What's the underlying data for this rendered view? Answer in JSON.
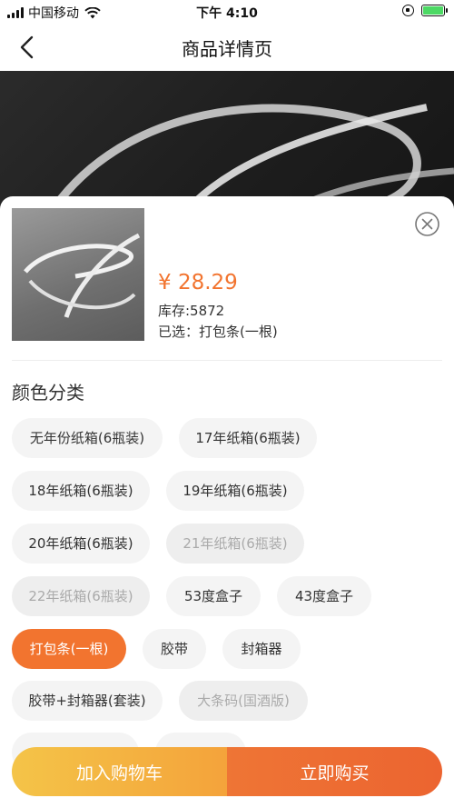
{
  "status_bar": {
    "carrier": "中国移动",
    "time": "下午 4:10"
  },
  "nav": {
    "title": "商品详情页"
  },
  "product": {
    "price": "¥ 28.29",
    "stock": "库存:5872",
    "selected": "已选：打包条(一根)"
  },
  "section": {
    "title": "颜色分类"
  },
  "options": [
    {
      "label": "无年份纸箱(6瓶装)",
      "state": "normal"
    },
    {
      "label": "17年纸箱(6瓶装)",
      "state": "normal"
    },
    {
      "label": "18年纸箱(6瓶装)",
      "state": "normal"
    },
    {
      "label": "19年纸箱(6瓶装)",
      "state": "normal"
    },
    {
      "label": "20年纸箱(6瓶装)",
      "state": "normal"
    },
    {
      "label": "21年纸箱(6瓶装)",
      "state": "disabled"
    },
    {
      "label": "22年纸箱(6瓶装)",
      "state": "disabled"
    },
    {
      "label": "53度盒子",
      "state": "normal"
    },
    {
      "label": "43度盒子",
      "state": "normal"
    },
    {
      "label": "打包条(一根)",
      "state": "selected"
    },
    {
      "label": "胶带",
      "state": "normal"
    },
    {
      "label": "封箱器",
      "state": "normal"
    },
    {
      "label": "胶带+封箱器(套装)",
      "state": "normal"
    },
    {
      "label": "大条码(国酒版)",
      "state": "disabled"
    }
  ],
  "actions": {
    "add_to_cart": "加入购物车",
    "buy_now": "立即购买"
  },
  "colors": {
    "accent": "#f2742f",
    "cart_gradient": [
      "#f4c448",
      "#f4a33b"
    ],
    "buy_gradient": [
      "#ee7535",
      "#ec6430"
    ]
  },
  "icons": [
    "signal-icon",
    "wifi-icon",
    "orientation-lock-icon",
    "battery-icon",
    "back-arrow-icon",
    "close-icon"
  ]
}
